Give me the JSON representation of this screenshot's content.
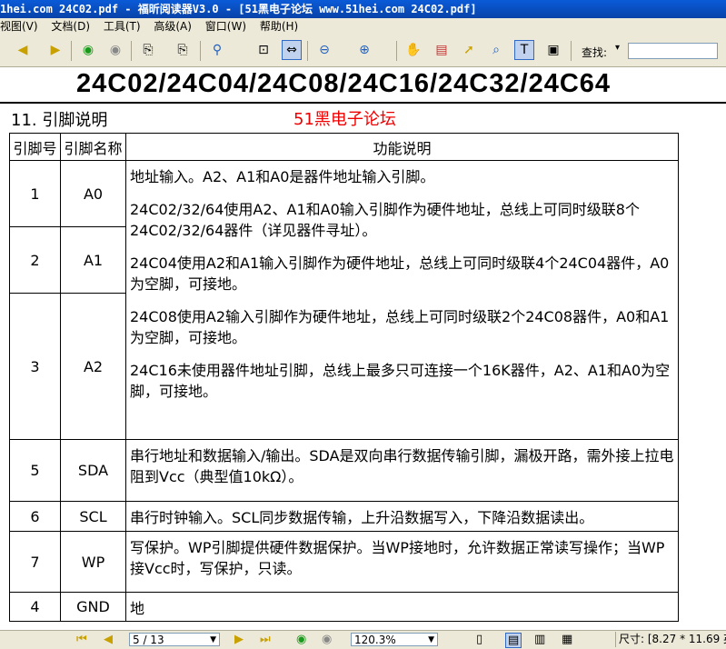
{
  "window": {
    "title": "1hei.com 24C02.pdf - 福昕阅读器V3.0 - [51黑电子论坛 www.51hei.com 24C02.pdf]"
  },
  "menu": [
    "视图(V)",
    "文档(D)",
    "工具(T)",
    "高级(A)",
    "窗口(W)",
    "帮助(H)"
  ],
  "toolbar": {
    "find_label": "查找:",
    "find_value": ""
  },
  "document": {
    "heading": "24C02/24C04/24C08/24C16/24C32/24C64",
    "section": "11. 引脚说明",
    "watermark": "51黑电子论坛",
    "table": {
      "headers": [
        "引脚号",
        "引脚名称",
        "功能说明"
      ],
      "rows": [
        {
          "pin": "1",
          "name": "A0"
        },
        {
          "pin": "2",
          "name": "A1"
        },
        {
          "pin": "3",
          "name": "A2"
        },
        {
          "pin": "5",
          "name": "SDA",
          "desc": "串行地址和数据输入/输出。SDA是双向串行数据传输引脚，漏极开路，需外接上拉电阻到Vcc（典型值10kΩ）。"
        },
        {
          "pin": "6",
          "name": "SCL",
          "desc": "串行时钟输入。SCL同步数据传输，上升沿数据写入，下降沿数据读出。"
        },
        {
          "pin": "7",
          "name": "WP",
          "desc": "写保护。WP引脚提供硬件数据保护。当WP接地时，允许数据正常读写操作；当WP接Vcc时，写保护，只读。"
        },
        {
          "pin": "4",
          "name": "GND",
          "desc": "地"
        }
      ],
      "address_desc": [
        "地址输入。A2、A1和A0是器件地址输入引脚。",
        "24C02/32/64使用A2、A1和A0输入引脚作为硬件地址，总线上可同时级联8个24C02/32/64器件（详见器件寻址）。",
        "24C04使用A2和A1输入引脚作为硬件地址，总线上可同时级联4个24C04器件，A0为空脚，可接地。",
        "24C08使用A2输入引脚作为硬件地址，总线上可同时级联2个24C08器件，A0和A1为空脚，可接地。",
        "24C16未使用器件地址引脚，总线上最多只可连接一个16K器件，A2、A1和A0为空脚，可接地。"
      ]
    }
  },
  "status": {
    "page": "5 / 13",
    "zoom": "120.3%",
    "size": "尺寸: [8.27 * 11.69 英"
  }
}
